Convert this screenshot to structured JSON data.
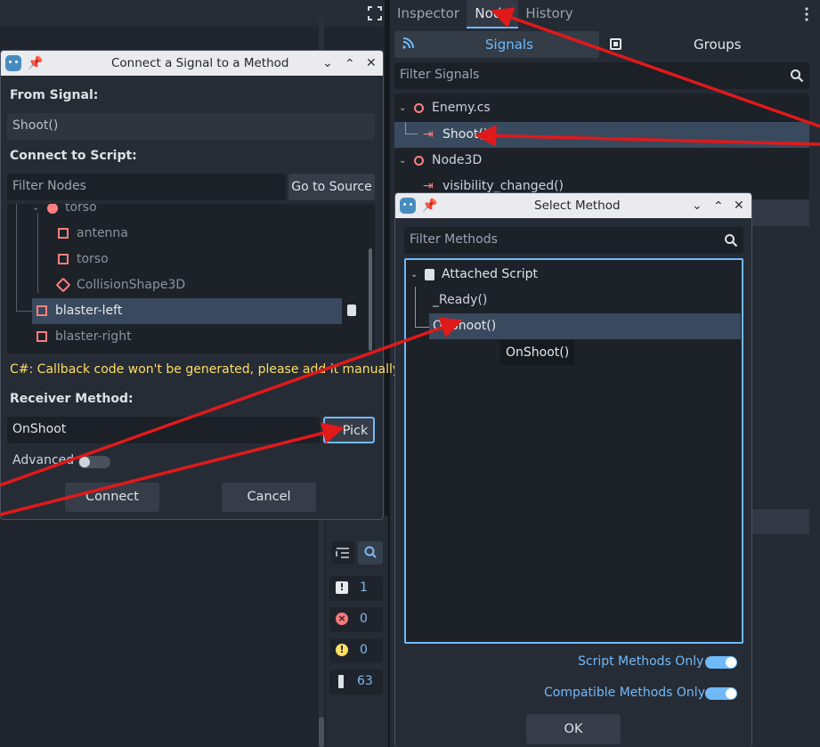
{
  "right_dock": {
    "tabs": [
      "Inspector",
      "Node",
      "History"
    ],
    "subtabs": {
      "signals": "Signals",
      "groups": "Groups"
    },
    "filter_placeholder": "Filter Signals",
    "tree": {
      "enemy": "Enemy.cs",
      "shoot": "Shoot()",
      "node3d": "Node3D",
      "visibility": "visibility_changed()"
    }
  },
  "connect_dialog": {
    "title": "Connect a Signal to a Method",
    "from_signal_label": "From Signal:",
    "from_signal_value": "Shoot()",
    "connect_to_label": "Connect to Script:",
    "filter_nodes_placeholder": "Filter Nodes",
    "go_to_source": "Go to Source",
    "nodes": [
      "torso",
      "antenna",
      "torso",
      "CollisionShape3D",
      "blaster-left",
      "blaster-right"
    ],
    "warning": "C#: Callback code won't be generated, please add it manually.",
    "receiver_label": "Receiver Method:",
    "receiver_value": "OnShoot",
    "pick": "Pick",
    "advanced": "Advanced",
    "connect": "Connect",
    "cancel": "Cancel"
  },
  "select_method_dialog": {
    "title": "Select Method",
    "filter_placeholder": "Filter Methods",
    "tree": {
      "root": "Attached Script",
      "ready": "_Ready()",
      "onshoot": "OnShoot()"
    },
    "tooltip": "OnShoot()",
    "script_only": "Script Methods Only",
    "compatible_only": "Compatible Methods Only",
    "ok": "OK"
  },
  "dock_counters": {
    "info": "1",
    "errors": "0",
    "warnings": "0",
    "misc": "63"
  },
  "colors": {
    "accent": "#70bafa",
    "selection": "#3a4a5e",
    "node_icon": "#fc7f7f",
    "warning_text": "#ffde66",
    "arrow": "#e0191b"
  }
}
